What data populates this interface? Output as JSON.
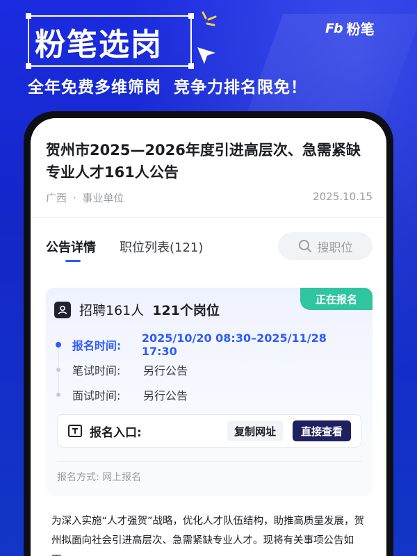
{
  "header": {
    "title": "粉笔选岗",
    "brand_mark": "Fb",
    "brand_name": "粉笔",
    "slogan_1": "全年免费多维筛岗",
    "slogan_2": "竞争力排名限免！"
  },
  "notice": {
    "title": "贺州市2025—2026年度引进高层次、急需紧缺专业人才161人公告",
    "region": "广西",
    "separator": "·",
    "category": "事业单位",
    "date": "2025.10.15"
  },
  "tabs": [
    {
      "label": "公告详情"
    },
    {
      "label": "职位列表(121)"
    }
  ],
  "search": {
    "label": "搜职位"
  },
  "card": {
    "status": "正在报名",
    "recruit_count": "招聘161人",
    "positions": "121个岗位",
    "timeline": [
      {
        "label": "报名时间:",
        "value": "2025/10/20 08:30–2025/11/28 17:30"
      },
      {
        "label": "笔试时间:",
        "value": "另行公告"
      },
      {
        "label": "面试时间:",
        "value": "另行公告"
      }
    ],
    "entry_label": "报名入口:",
    "copy_button": "复制网址",
    "view_button": "直接查看",
    "apply_method": "报名方式:  网上报名"
  },
  "body_text": "为深入实施“人才强贺”战略，优化人才队伍结构，助推高质量发展，贺州拟面向社会引进高层次、急需紧缺专业人才。现将有关事项公告如下：",
  "colors": {
    "background": "#1a2ad0",
    "accent": "#2e5bff",
    "status_green": "#2ec5a0",
    "primary_button": "#1f2060"
  }
}
